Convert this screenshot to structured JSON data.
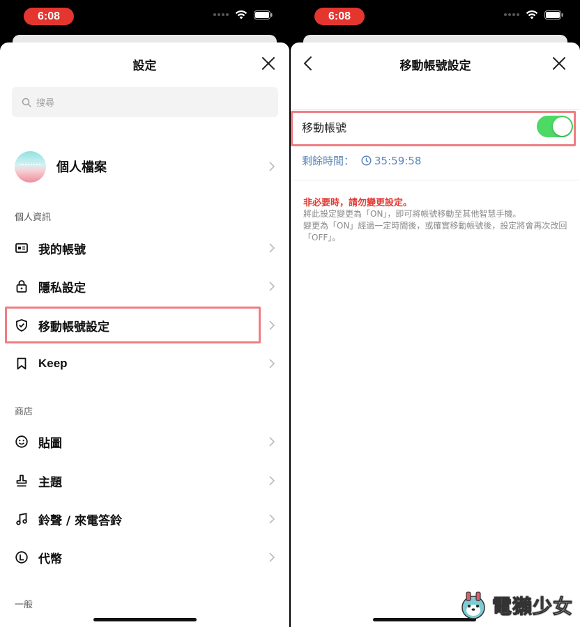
{
  "status_bar": {
    "time": "6:08"
  },
  "left": {
    "title": "設定",
    "search": {
      "placeholder": "搜尋"
    },
    "profile": {
      "label": "個人檔案"
    },
    "sections": [
      {
        "header": "個人資訊",
        "items": [
          "我的帳號",
          "隱私設定",
          "移動帳號設定",
          "Keep"
        ]
      },
      {
        "header": "商店",
        "items": [
          "貼圖",
          "主題",
          "鈴聲 / 來電答鈴",
          "代幣"
        ]
      },
      {
        "header": "一般"
      }
    ]
  },
  "right": {
    "title": "移動帳號設定",
    "toggle": {
      "label": "移動帳號",
      "state": "on",
      "color": "#4cd964"
    },
    "remaining": {
      "label": "剩餘時間：",
      "time": "35:59:58"
    },
    "warning": {
      "title": "非必要時，請勿變更設定。",
      "line1": "將此設定變更為「ON」，即可將帳號移動至其他智慧手機。",
      "line2": "變更為「ON」經過一定時間後，或確實移動帳號後，設定將會再次改回「OFF」。"
    }
  },
  "watermark": {
    "text": "電獺少女"
  },
  "colors": {
    "highlight": "#ef7d82",
    "time_pill": "#e5352f",
    "warning": "#e23b35",
    "link_blue": "#5a84b8"
  }
}
